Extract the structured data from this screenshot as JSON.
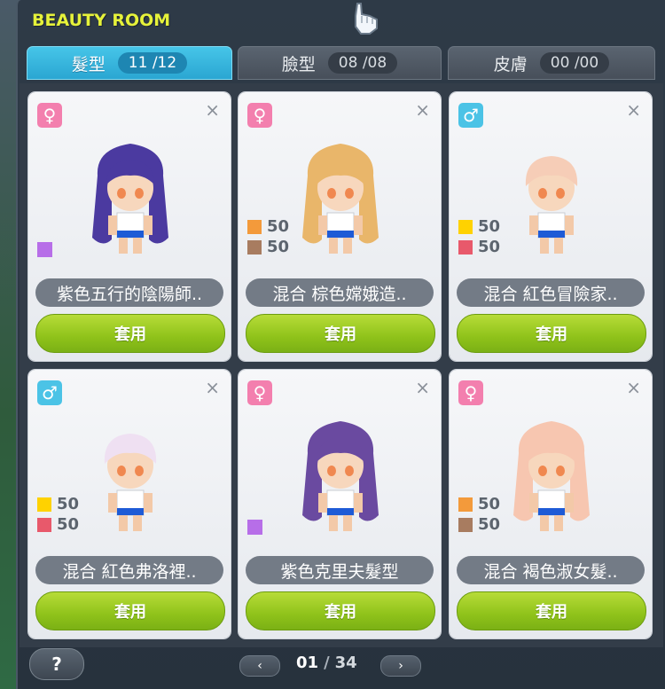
{
  "window": {
    "title": "BEAUTY ROOM"
  },
  "tabs": [
    {
      "label": "髮型",
      "count": "11 /12",
      "active": true
    },
    {
      "label": "臉型",
      "count": "08 /08",
      "active": false
    },
    {
      "label": "皮膚",
      "count": "00 /00",
      "active": false
    }
  ],
  "cards": [
    {
      "gender": "♀",
      "gender_type": "female",
      "name": "紫色五行的陰陽師..",
      "apply": "套用",
      "close": "×",
      "colors": [],
      "single_color": "#b76ee8",
      "hair_color": "#4b3aa0"
    },
    {
      "gender": "♀",
      "gender_type": "female",
      "name": "混合  棕色嫦娥造..",
      "apply": "套用",
      "close": "×",
      "colors": [
        {
          "color": "#f39a3b",
          "value": "50"
        },
        {
          "color": "#a87c60",
          "value": "50"
        }
      ],
      "hair_color": "#e9b66a"
    },
    {
      "gender": "♂",
      "gender_type": "male",
      "name": "混合  紅色冒險家..",
      "apply": "套用",
      "close": "×",
      "colors": [
        {
          "color": "#ffd200",
          "value": "50"
        },
        {
          "color": "#e8596b",
          "value": "50"
        }
      ],
      "hair_color": "#f6cdb7"
    },
    {
      "gender": "♂",
      "gender_type": "male",
      "name": "混合  紅色弗洛裡..",
      "apply": "套用",
      "close": "×",
      "colors": [
        {
          "color": "#ffd200",
          "value": "50"
        },
        {
          "color": "#e8596b",
          "value": "50"
        }
      ],
      "hair_color": "#efe0f2"
    },
    {
      "gender": "♀",
      "gender_type": "female",
      "name": "紫色克里夫髮型",
      "apply": "套用",
      "close": "×",
      "colors": [],
      "single_color": "#b76ee8",
      "hair_color": "#6a4aa0"
    },
    {
      "gender": "♀",
      "gender_type": "female",
      "name": "混合  褐色淑女髮..",
      "apply": "套用",
      "close": "×",
      "colors": [
        {
          "color": "#f39a3b",
          "value": "50"
        },
        {
          "color": "#a87c60",
          "value": "50"
        }
      ],
      "hair_color": "#f7c6b0"
    }
  ],
  "footer": {
    "help": "?",
    "prev": "‹",
    "next": "›",
    "page_current": "01",
    "page_sep": "/",
    "page_total": "34"
  }
}
